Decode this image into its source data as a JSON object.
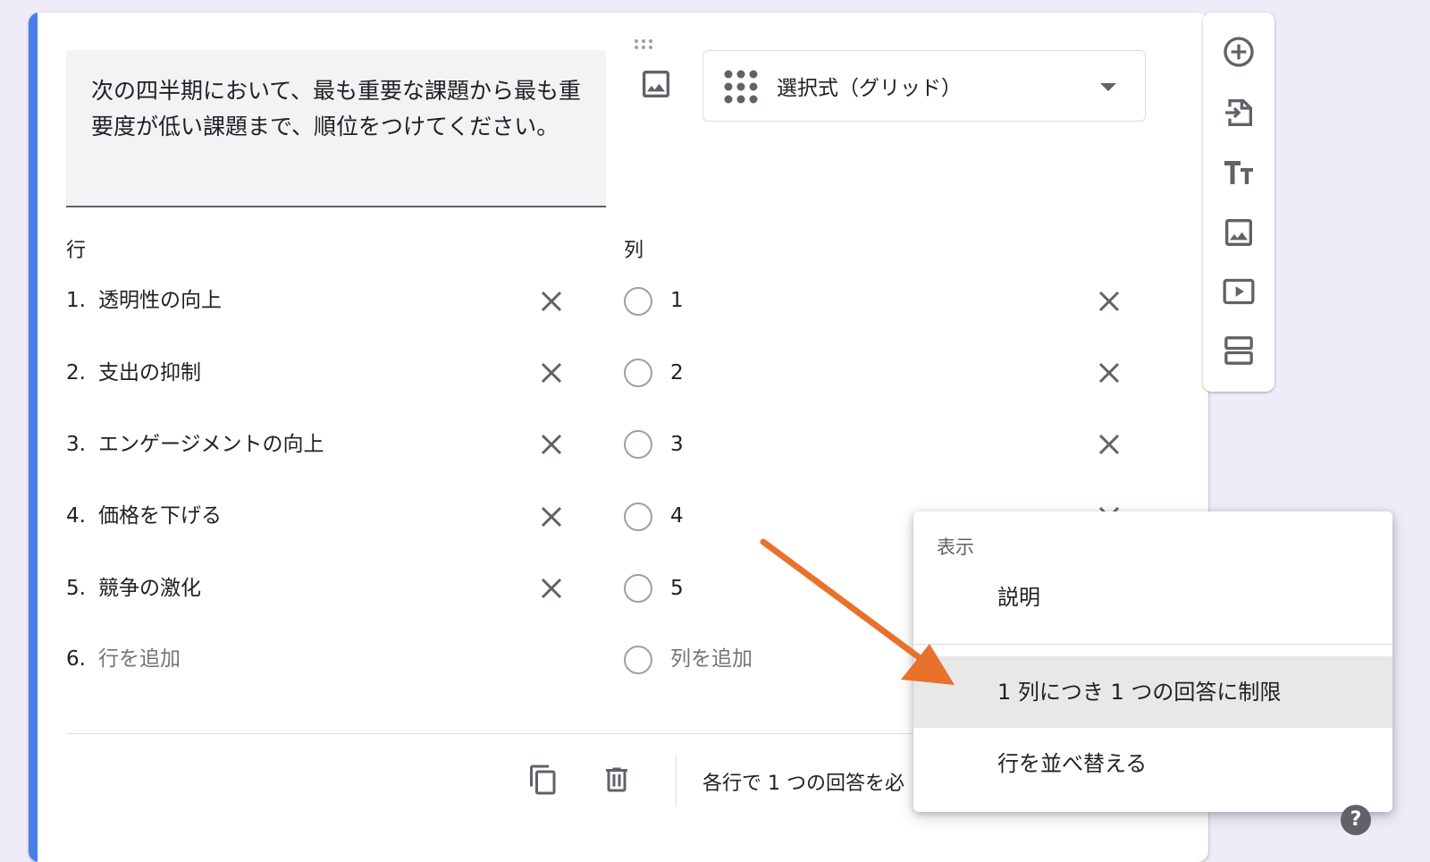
{
  "question": {
    "text": "次の四半期において、最も重要な課題から最も重要度が低い課題まで、順位をつけてください。",
    "type_label": "選択式（グリッド）"
  },
  "rows_heading": "行",
  "columns_heading": "列",
  "rows": [
    {
      "num": "1.",
      "label": "透明性の向上"
    },
    {
      "num": "2.",
      "label": "支出の抑制"
    },
    {
      "num": "3.",
      "label": "エンゲージメントの向上"
    },
    {
      "num": "4.",
      "label": "価格を下げる"
    },
    {
      "num": "5.",
      "label": "競争の激化"
    }
  ],
  "add_row": {
    "num": "6.",
    "placeholder": "行を追加"
  },
  "columns": [
    "1",
    "2",
    "3",
    "4",
    "5"
  ],
  "add_column": {
    "placeholder": "列を追加"
  },
  "footer": {
    "required_text": "各行で 1 つの回答を必"
  },
  "menu": {
    "section_label": "表示",
    "items": [
      "説明",
      "1 列につき 1 つの回答に制限",
      "行を並べ替える"
    ],
    "highlighted_index": 1
  },
  "help": {
    "label": "?"
  },
  "colors": {
    "accent": "#4a7fe8",
    "arrow": "#e8722c"
  }
}
